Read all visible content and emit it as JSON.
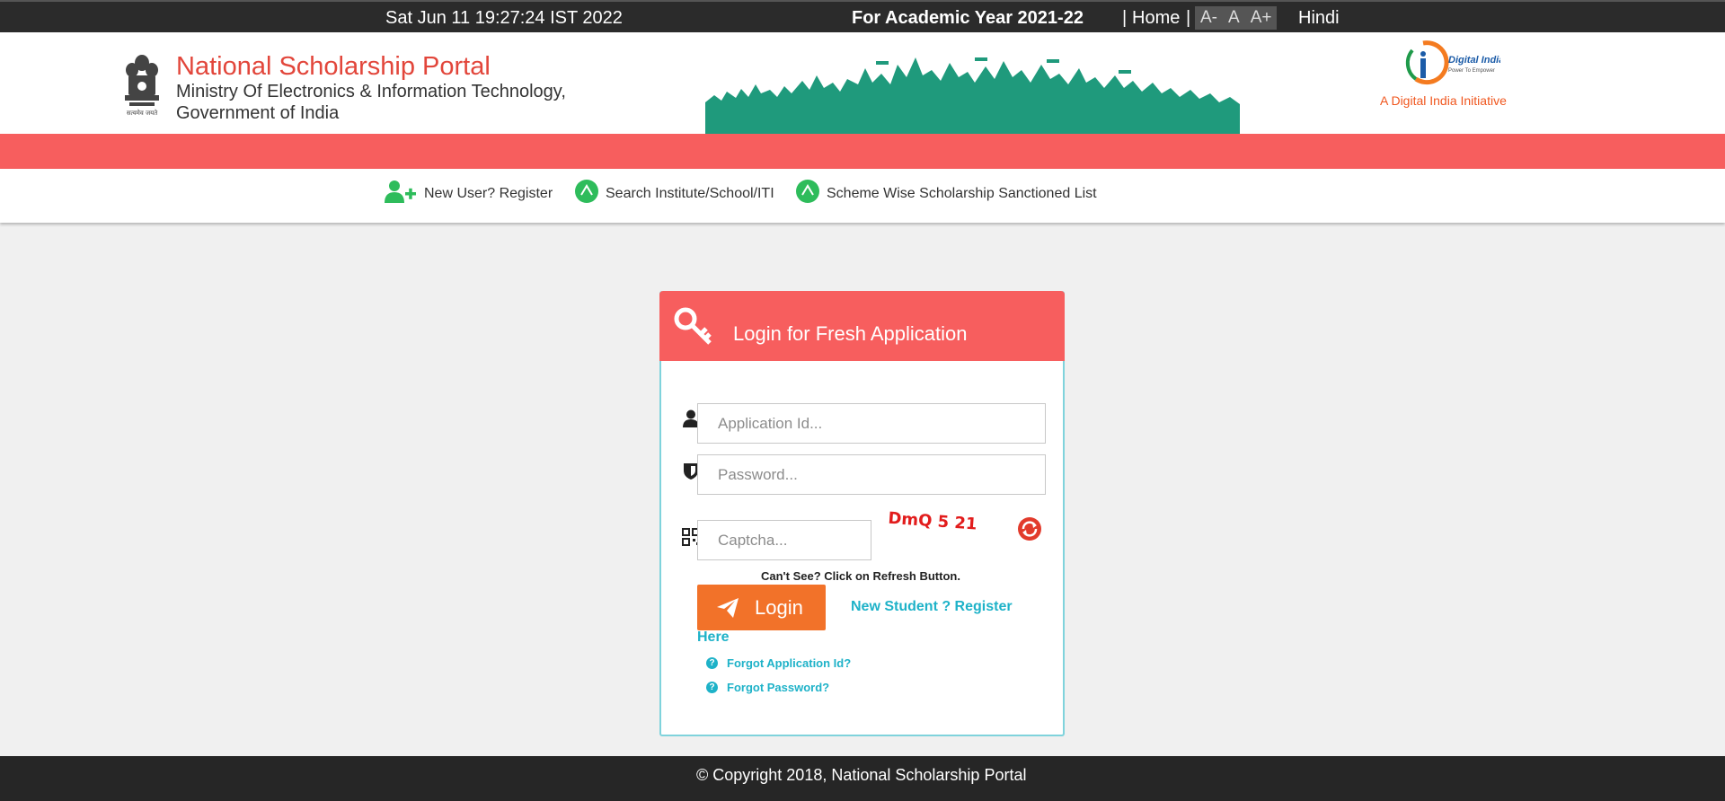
{
  "topbar": {
    "datetime": "Sat Jun 11 19:27:24 IST 2022",
    "academic_year": "For Academic Year 2021-22",
    "sep1": "|",
    "home": "Home",
    "sep2": "|",
    "font_decrease": "A-",
    "font_normal": "A",
    "font_increase": "A+",
    "language": "Hindi"
  },
  "header": {
    "title": "National Scholarship Portal",
    "subtitle_line1": "Ministry Of Electronics & Information Technology,",
    "subtitle_line2": "Government of India",
    "digital_india_logo_text": "Digital India",
    "digital_india_logo_sub": "Power To Empower",
    "digital_india_tagline": "A Digital India Initiative"
  },
  "nav": {
    "items": [
      {
        "label": "New User? Register",
        "icon": "add-user-icon"
      },
      {
        "label": "Search Institute/School/ITI",
        "icon": "arrow-up-circle-icon"
      },
      {
        "label": "Scheme Wise Scholarship Sanctioned List",
        "icon": "arrow-up-circle-icon"
      }
    ]
  },
  "login": {
    "title": "Login for Fresh Application",
    "application_id_placeholder": "Application Id...",
    "password_placeholder": "Password...",
    "captcha_placeholder": "Captcha...",
    "captcha_text": "DmQ 5 21",
    "cant_see": "Can't See? Click on Refresh Button.",
    "login_button": "Login",
    "register_line1": "New Student ? Register",
    "register_line2": "Here",
    "forgot_application_id": "Forgot Application Id?",
    "forgot_password": "Forgot Password?"
  },
  "footer": {
    "copyright": "© Copyright 2018, National Scholarship Portal"
  },
  "colors": {
    "accent_red": "#f75e5e",
    "login_orange": "#f27229",
    "link_teal": "#1eb2c8",
    "nav_green": "#2ebc5b",
    "title_red": "#e2463b"
  }
}
